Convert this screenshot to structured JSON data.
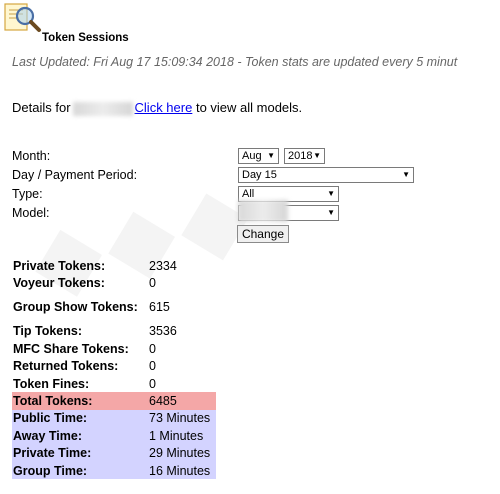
{
  "header": {
    "title": "Token Sessions",
    "last_updated": "Last Updated: Fri Aug 17 15:09:34 2018 - Token stats are updated every 5 minut"
  },
  "details": {
    "prefix": "Details for",
    "link_text": "Click here",
    "suffix": "to view all models."
  },
  "form": {
    "month_label": "Month:",
    "month_value": "Aug",
    "year_value": "2018",
    "period_label": "Day / Payment Period:",
    "period_value": "Day 15",
    "type_label": "Type:",
    "type_value": "All",
    "model_label": "Model:",
    "submit_label": "Change"
  },
  "stats": [
    {
      "label": "Private Tokens:",
      "value": "2334"
    },
    {
      "label": "Voyeur Tokens:",
      "value": "0"
    },
    {
      "label": "Group Show Tokens:",
      "value": "615"
    },
    {
      "label": "Tip Tokens:",
      "value": "3536"
    },
    {
      "label": "MFC Share Tokens:",
      "value": "0"
    },
    {
      "label": "Returned Tokens:",
      "value": "0"
    },
    {
      "label": "Token Fines:",
      "value": "0"
    },
    {
      "label": "Total Tokens:",
      "value": "6485"
    },
    {
      "label": "Public Time:",
      "value": "73 Minutes"
    },
    {
      "label": "Away Time:",
      "value": "1 Minutes"
    },
    {
      "label": "Private Time:",
      "value": "29 Minutes"
    },
    {
      "label": "Group Time:",
      "value": "16 Minutes"
    }
  ],
  "colors": {
    "total_highlight": "#f4a7a7",
    "time_highlight": "#d3d3ff",
    "link": "#0000ee"
  },
  "icons": {
    "logo": "magnifier-document-icon"
  }
}
